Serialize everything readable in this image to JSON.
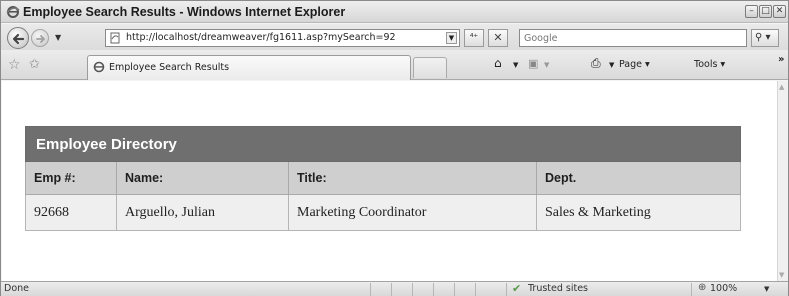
{
  "window": {
    "title": "Employee Search Results - Windows Internet Explorer",
    "minimize_glyph": "–",
    "maximize_glyph": "□",
    "close_glyph": "✕"
  },
  "address_bar": {
    "url": "http://localhost/dreamweaver/fg1611.asp?mySearch=92",
    "search_placeholder": "Google",
    "refresh_glyph": "⁴⁺",
    "stop_glyph": "✕",
    "search_glyph": "⚲ ▾"
  },
  "tabs": [
    {
      "label": "Employee Search Results"
    }
  ],
  "command_bar": {
    "home_glyph": "⌂",
    "feeds_glyph": "▣",
    "print_glyph": "⎙",
    "dropdown_glyph": "▼",
    "page_label": "Page ▾",
    "tools_label": "Tools ▾",
    "more_glyph": "»"
  },
  "favorites": {
    "star_glyph": "☆",
    "add_glyph": "✩"
  },
  "employee_table": {
    "caption": "Employee Directory",
    "columns": [
      "Emp #:",
      "Name:",
      "Title:",
      "Dept."
    ],
    "rows": [
      [
        "92668",
        "Arguello, Julian",
        "Marketing Coordinator",
        "Sales & Marketing"
      ]
    ]
  },
  "status_bar": {
    "text": "Done",
    "zone": "Trusted sites",
    "zone_glyph": "✔",
    "zoom": "100%",
    "zoom_glyph": "⊕",
    "zoom_dd_glyph": "▼"
  },
  "scrollbar": {
    "up_glyph": "▲",
    "down_glyph": "▼"
  },
  "icons": {
    "ie_logo": "ie-logo-icon",
    "back": "back-arrow-icon",
    "forward": "forward-arrow-icon",
    "page": "page-icon"
  },
  "colors": {
    "caption_bg": "#6f6f6f",
    "header_bg": "#cfcfcf",
    "row_bg": "#efefef"
  }
}
